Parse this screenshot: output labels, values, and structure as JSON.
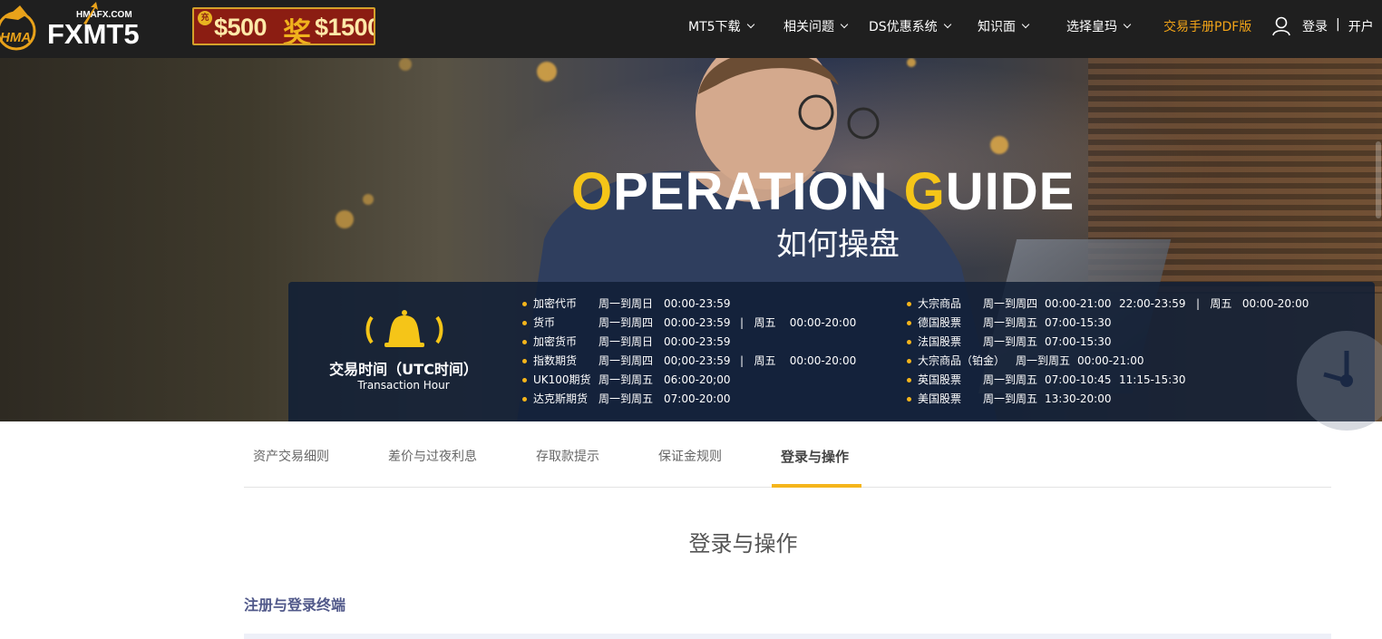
{
  "header": {
    "logo_text": "FXMT5",
    "logo_domain": "HMAFX.COM",
    "logo_badge": "HMA",
    "promo": {
      "left": "$500",
      "mid": "奖",
      "right": "$1500",
      "dot": "充"
    },
    "nav": [
      {
        "label": "MT5下载",
        "has_dropdown": true
      },
      {
        "label": "相关问题",
        "has_dropdown": true
      },
      {
        "label": "DS优惠系统",
        "has_dropdown": true
      },
      {
        "label": "知识面",
        "has_dropdown": true
      },
      {
        "label": "选择皇玛",
        "has_dropdown": true
      },
      {
        "label": "交易手册PDF版",
        "has_dropdown": false
      }
    ],
    "login": "登录",
    "separator": "|",
    "register": "开户",
    "accent_color": "#f2a418"
  },
  "hero": {
    "title_first_hl": "O",
    "title_first_rest": "PERATION ",
    "title_second_hl": "G",
    "title_second_rest": "UIDE",
    "subtitle": "如何操盘",
    "panel": {
      "title": "交易时间（UTC时间）",
      "subtitle": "Transaction Hour",
      "icon": "bell-icon",
      "left_list": [
        {
          "name": "加密代币",
          "days": "周一到周日",
          "time": "00:00-23:59",
          "extra": ""
        },
        {
          "name": "货币",
          "days": "周一到周四",
          "time": "00:00-23:59",
          "extra": "|   周五    00:00-20:00"
        },
        {
          "name": "加密货币",
          "days": "周一到周日",
          "time": "00:00-23:59",
          "extra": ""
        },
        {
          "name": "指数期货",
          "days": "周一到周四",
          "time": "00;00-23:59",
          "extra": "|   周五    00:00-20:00"
        },
        {
          "name": "UK100期货",
          "days": "周一到周五",
          "time": "06:00-20;00",
          "extra": ""
        },
        {
          "name": "达克斯期货",
          "days": "周一到周五",
          "time": "07:00-20:00",
          "extra": ""
        }
      ],
      "right_list": [
        {
          "name": "大宗商品",
          "days": "周一到周四",
          "time": "00:00-21:00",
          "extra": "22:00-23:59   |   周五   00:00-20:00"
        },
        {
          "name": "德国股票",
          "days": "周一到周五",
          "time": "07:00-15:30",
          "extra": ""
        },
        {
          "name": "法国股票",
          "days": "周一到周五",
          "time": "07:00-15:30",
          "extra": ""
        },
        {
          "name": "大宗商品（铂金）",
          "days": "周一到周五",
          "time": "00:00-21:00",
          "extra": ""
        },
        {
          "name": "英国股票",
          "days": "周一到周五",
          "time": "07:00-10:45",
          "extra": "11:15-15:30"
        },
        {
          "name": "美国股票",
          "days": "周一到周五",
          "time": "13:30-20:00",
          "extra": ""
        }
      ],
      "highlight_color": "#f5c518"
    }
  },
  "tabs": [
    {
      "label": "资产交易细则",
      "active": false
    },
    {
      "label": "差价与过夜利息",
      "active": false
    },
    {
      "label": "存取款提示",
      "active": false
    },
    {
      "label": "保证金规则",
      "active": false
    },
    {
      "label": "登录与操作",
      "active": true
    }
  ],
  "content": {
    "section_title": "登录与操作",
    "subheading": "注册与登录终端"
  }
}
